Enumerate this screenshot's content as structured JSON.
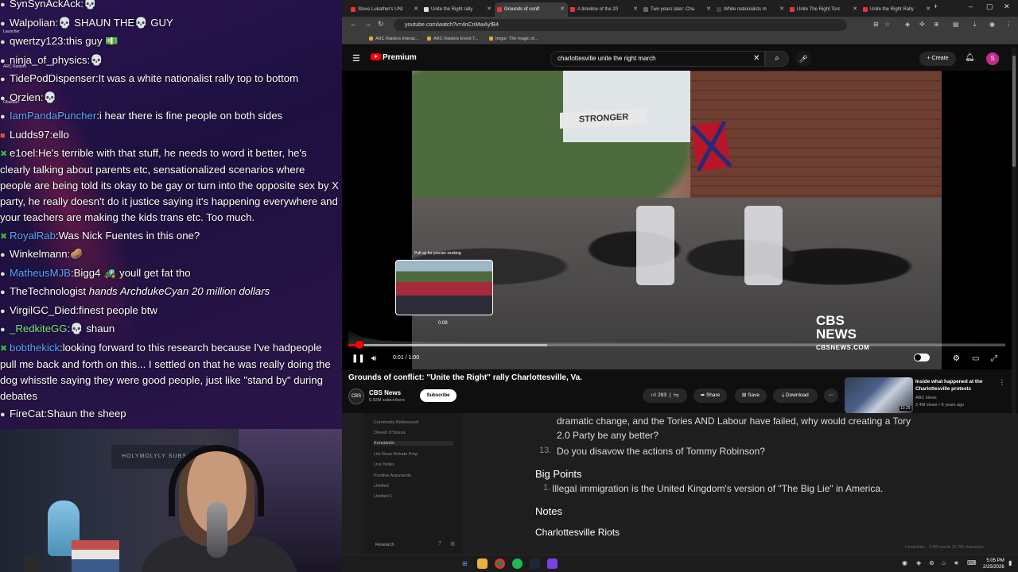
{
  "chat": {
    "side_labels": [
      "Launcher",
      "ARC Raiders",
      "Obsidian"
    ],
    "messages": [
      {
        "badge": "dot",
        "user": "SynSynAckAck",
        "user_color": "white",
        "msg": ":💀"
      },
      {
        "badge": "dot",
        "user": "Walpolian",
        "user_color": "white",
        "msg": ":💀 SHAUN THE💀 GUY"
      },
      {
        "badge": "dot",
        "user": "qwertzy123",
        "user_color": "white",
        "msg": ":this guy 💵"
      },
      {
        "badge": "dot",
        "user": "ninja_of_physics",
        "user_color": "white",
        "msg": ":💀"
      },
      {
        "badge": "dot",
        "user": "TidePodDispenser",
        "user_color": "white",
        "msg": ":It was a white nationalist rally top to bottom"
      },
      {
        "badge": "dot",
        "user": "Orzien",
        "user_color": "white",
        "msg": ":💀"
      },
      {
        "badge": "dot",
        "user": "IamPandaPuncher",
        "user_color": "blue",
        "msg": ":i hear there is fine people on both sides"
      },
      {
        "badge": "sub",
        "user": "Ludds97",
        "user_color": "white",
        "msg": ":ello"
      },
      {
        "badge": "mod",
        "user": "e1oel",
        "user_color": "white",
        "msg": ":He's terrible with that stuff, he needs to word it better, he's clearly talking about parents etc, sensationalized scenarios where people are being told its okay to be gay or turn into the opposite sex by X party, he really doesn't do it justice saying it's happening everywhere and your teachers are making the kids trans etc. Too much."
      },
      {
        "badge": "mod",
        "user": "RoyalRab",
        "user_color": "blue",
        "msg": ":Was Nick Fuentes in this one?"
      },
      {
        "badge": "dot",
        "user": "Winkelmann",
        "user_color": "white",
        "msg": ":🥔"
      },
      {
        "badge": "dot",
        "user": "MatheusMJB",
        "user_color": "blue",
        "msg": ":Bigg4 🚜 youll get fat tho"
      },
      {
        "badge": "dot",
        "user": "TheTechnologist",
        "user_color": "white",
        "msg": " hands ArchdukeCyan 20 million dollars",
        "italic": true
      },
      {
        "badge": "dot",
        "user": "VirgilGC_Died",
        "user_color": "white",
        "msg": ":finest people btw"
      },
      {
        "badge": "dot",
        "user": "_RedkiteGG",
        "user_color": "green",
        "msg": ":💀 shaun"
      },
      {
        "badge": "mod",
        "user": "bobthekick",
        "user_color": "blue",
        "msg": ":looking forward to this research because I've hadpeople pull me back and forth on this... I settled on that he was really doing the dog whisstle saying they were good people, just like \"stand by\" during debates"
      },
      {
        "badge": "dot",
        "user": "FireCat",
        "user_color": "white",
        "msg": ":Shaun the sheep"
      }
    ]
  },
  "webcam": {
    "sign": "HOLYMOLYLY SUBSCR"
  },
  "browser": {
    "tabs": [
      {
        "label": "Steve Lukather's UNI",
        "active": false
      },
      {
        "label": "Unite the Right rally",
        "active": false
      },
      {
        "label": "Grounds of confl",
        "active": true
      },
      {
        "label": "A timeline of the 20",
        "active": false
      },
      {
        "label": "Two years later: Cha",
        "active": false
      },
      {
        "label": "White nationalists m",
        "active": false
      },
      {
        "label": "Unite The Right Torc",
        "active": false
      },
      {
        "label": "Unite the Right Rally",
        "active": false
      }
    ],
    "url": "youtube.com/watch?v=4nCnMwAyfB4",
    "bookmarks": [
      "ARC Raiders Interac...",
      "ARC Raiders Event T...",
      "Imgur: The magic of..."
    ]
  },
  "youtube": {
    "logo": "Premium",
    "search_query": "charlottesville unite the right march",
    "create_label": "Create",
    "avatar_letter": "S",
    "video": {
      "banner_text": "STRONGER",
      "watermark": "CBS",
      "watermark_sub": "NEWS",
      "watermark_url": "CBSNEWS.COM",
      "preview_tip": "Pull up for precise seeking",
      "preview_time": "0:08",
      "time": "0:01 / 1:00",
      "progress_fraction": 0.017
    },
    "title": "Grounds of conflict: \"Unite the Right\" rally Charlottesville, Va.",
    "channel": "CBS News",
    "subscribers": "6.92M subscribers",
    "subscribe_label": "Subscribe",
    "likes": "293",
    "share_label": "Share",
    "save_label": "Save",
    "download_label": "Download",
    "related": {
      "title": "Inside what happened at the Charlottesville protests",
      "channel": "ABC News",
      "meta": "2.4M views • 8 years ago",
      "duration": "10:29"
    }
  },
  "notes": {
    "sidebar": [
      "Commonly Referenced",
      "Dinesh D'Souza",
      "Konstantin",
      "Lila Rose Debate Prep",
      "Live Notes",
      "Positive Arguments",
      "Untitled",
      "Untitled 1"
    ],
    "active_item": "Konstantin",
    "footer": "Research",
    "lines": [
      "dramatic change, and the Tories AND Labour have failed, why would creating a Tory",
      "2.0 Party be any better?"
    ],
    "item13_num": "13.",
    "item13": "Do you disavow the actions of Tommy Robinson?",
    "h_big_points": "Big Points",
    "bp1_num": "1.",
    "bp1": "Illegal immigration is the United Kingdom's version of \"The Big Lie\" in America.",
    "h_notes": "Notes",
    "h_riots": "Charlottesville Riots",
    "status_backlinks": "0 backlinks",
    "status_words": "2,489 words  15,769 characters"
  },
  "taskbar": {
    "time": "5:05 PM",
    "date": "2/25/2026"
  }
}
